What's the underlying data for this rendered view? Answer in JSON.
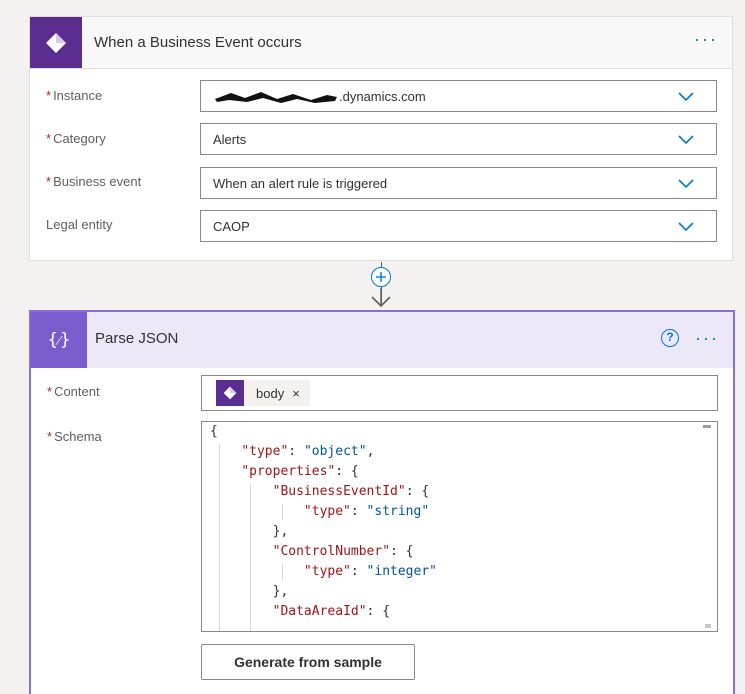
{
  "trigger_card": {
    "title": "When a Business Event occurs",
    "more_label": "···",
    "fields": [
      {
        "label": "Instance",
        "required": true,
        "value": ".dynamics.com"
      },
      {
        "label": "Category",
        "required": true,
        "value": "Alerts"
      },
      {
        "label": "Business event",
        "required": true,
        "value": "When an alert rule is triggered"
      },
      {
        "label": "Legal entity",
        "required": false,
        "value": "CAOP"
      }
    ]
  },
  "required_marker": "*",
  "connector": {
    "icon": "plus-icon"
  },
  "parse_card": {
    "title": "Parse JSON",
    "help_label": "?",
    "more_label": "···",
    "content_label": "Content",
    "content_token": "body",
    "content_token_remove": "×",
    "schema_label": "Schema",
    "schema_lines": [
      "{",
      "    \"type\": \"object\",",
      "    \"properties\": {",
      "        \"BusinessEventId\": {",
      "            \"type\": \"string\"",
      "        },",
      "        \"ControlNumber\": {",
      "            \"type\": \"integer\"",
      "        },",
      "        \"DataAreaId\": {"
    ],
    "generate_button": "Generate from sample"
  },
  "colors": {
    "accent": "#0078d4",
    "trigger_icon": "#5b2d90",
    "parse_icon": "#7b5ccc",
    "parse_header": "#ede8f8",
    "required": "#a4262c"
  }
}
